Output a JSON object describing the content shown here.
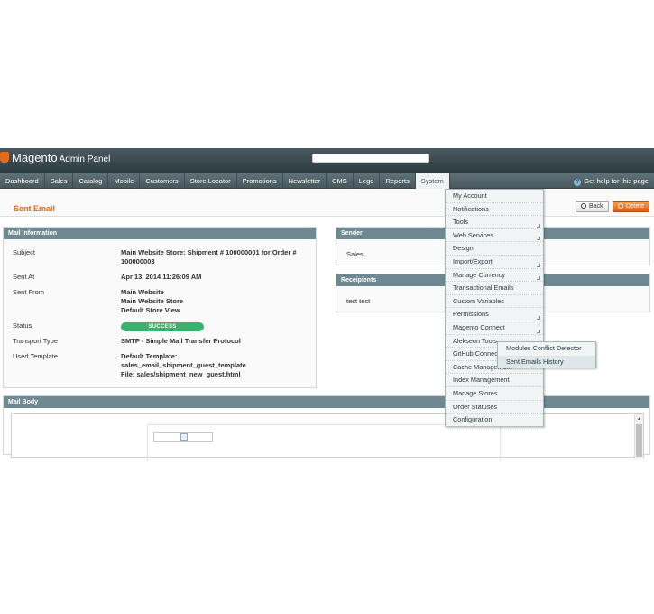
{
  "header": {
    "logo": "Magento",
    "logo_sub": "Admin Panel"
  },
  "nav": {
    "items": [
      "Dashboard",
      "Sales",
      "Catalog",
      "Mobile",
      "Customers",
      "Store Locator",
      "Promotions",
      "Newsletter",
      "CMS",
      "Lego",
      "Reports",
      "System"
    ],
    "active": "System",
    "help": "Get help for this page"
  },
  "page": {
    "title": "Sent Email",
    "back_label": "Back",
    "delete_label": "Delete"
  },
  "mail_info": {
    "header": "Mail Information",
    "subject_label": "Subject",
    "subject_value": "Main Website Store: Shipment # 100000001 for Order # 100000003",
    "sent_at_label": "Sent At",
    "sent_at_value": "Apr 13, 2014 11:26:09 AM",
    "sent_from_label": "Sent From",
    "sent_from_lines": [
      "Main Website",
      "Main Website Store",
      "Default Store View"
    ],
    "status_label": "Status",
    "status_value": "SUCCESS",
    "transport_label": "Transport Type",
    "transport_value": "SMTP - Simple Mail Transfer Protocol",
    "template_label": "Used Template",
    "template_lines": [
      "Default Template:",
      "sales_email_shipment_guest_template",
      "File: sales/shipment_new_guest.html"
    ]
  },
  "sender": {
    "header": "Sender",
    "value": "Sales"
  },
  "recipients": {
    "header": "Receipients",
    "value": "test test"
  },
  "mail_body": {
    "header": "Mail Body"
  },
  "system_menu": {
    "items": [
      "My Account",
      "Notifications",
      "Tools",
      "Web Services",
      "Design",
      "Import/Export",
      "Manage Currency",
      "Transactional Emails",
      "Custom Variables",
      "Permissions",
      "Magento Connect",
      "Aleksеon Tools",
      "GitHub Connect",
      "Cache Management",
      "Index Management",
      "Manage Stores",
      "Order Statuses",
      "Configuration"
    ],
    "submenu": [
      "Modules Conflict Detector",
      "Sent Emails History"
    ]
  },
  "colors": {
    "accent": "#eb5e00",
    "section_header": "#6f8992",
    "success": "#3ab26e"
  }
}
